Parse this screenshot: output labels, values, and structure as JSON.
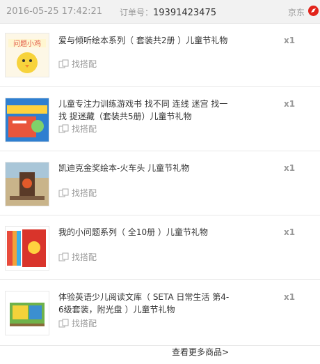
{
  "header": {
    "date": "2016-05-25 17:42:21",
    "order_label": "订单号：",
    "order_number": "19391423475",
    "shop": "京东",
    "accent": "#e2231a"
  },
  "items": [
    {
      "title": "爱与倾听绘本系列（ 套装共2册 ）儿童节礼物",
      "qty": "x1",
      "match": "找搭配"
    },
    {
      "title": "儿童专注力训练游戏书 找不同 连线 迷宫 找一找 捉迷藏（套装共5册）儿童节礼物",
      "qty": "x1",
      "match": "找搭配"
    },
    {
      "title": "凯迪克金奖绘本-火车头 儿童节礼物",
      "qty": "x1",
      "match": "找搭配"
    },
    {
      "title": "我的小问题系列（ 全10册 ）儿童节礼物",
      "qty": "x1",
      "match": "找搭配"
    },
    {
      "title": "体验英语少儿阅读文库（ SETA 日常生活 第4-6级套装，附光盘 ）儿童节礼物",
      "qty": "x1",
      "match": "找搭配"
    }
  ],
  "more_link": "查看更多商品>"
}
